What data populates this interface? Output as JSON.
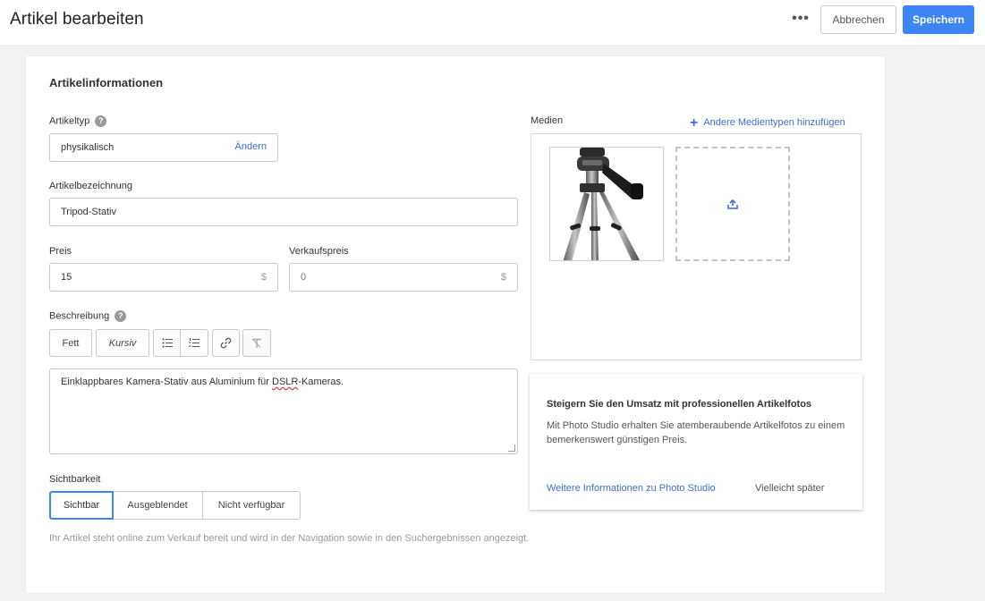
{
  "header": {
    "title": "Artikel bearbeiten",
    "more_label": "•••",
    "cancel_label": "Abbrechen",
    "save_label": "Speichern"
  },
  "colors": {
    "primary": "#3d85f5",
    "link": "#3d6fd8",
    "muted": "#9a9a9a"
  },
  "section": {
    "title": "Artikelinformationen",
    "item_type": {
      "label": "Artikeltyp",
      "value": "physikalisch",
      "change_label": "Ändern"
    },
    "item_name": {
      "label": "Artikelbezeichnung",
      "value": "Tripod-Stativ"
    },
    "price": {
      "label": "Preis",
      "value": "15",
      "currency": "$"
    },
    "sale_price": {
      "label": "Verkaufspreis",
      "placeholder": "0",
      "currency": "$"
    },
    "description": {
      "label": "Beschreibung",
      "toolbar": {
        "bold": "Fett",
        "italic": "Kursiv",
        "icons": [
          "bulleted-list-icon",
          "numbered-list-icon",
          "link-icon",
          "clear-format-icon"
        ]
      },
      "text_before": "Einklappbares Kamera-Stativ aus Aluminium für ",
      "text_flagged": "DSLR",
      "text_after": "-Kameras."
    },
    "visibility": {
      "label": "Sichtbarkeit",
      "options": [
        "Sichtbar",
        "Ausgeblendet",
        "Nicht verfügbar"
      ],
      "selected": "Sichtbar",
      "help": "Ihr Artikel steht online zum Verkauf bereit und wird in der Navigation sowie in den Suchergebnissen angezeigt."
    }
  },
  "media": {
    "label": "Medien",
    "add_label": "Andere Medientypen hinzufügen",
    "add_icon": "plus-icon",
    "upload_icon": "upload-icon"
  },
  "promo": {
    "title": "Steigern Sie den Umsatz mit professionellen Artikelfotos",
    "text": "Mit Photo Studio erhalten Sie atemberaubende Artikelfotos zu einem bemerkenswert günstigen Preis.",
    "link_label": "Weitere Informationen zu Photo Studio",
    "later_label": "Vielleicht später"
  }
}
